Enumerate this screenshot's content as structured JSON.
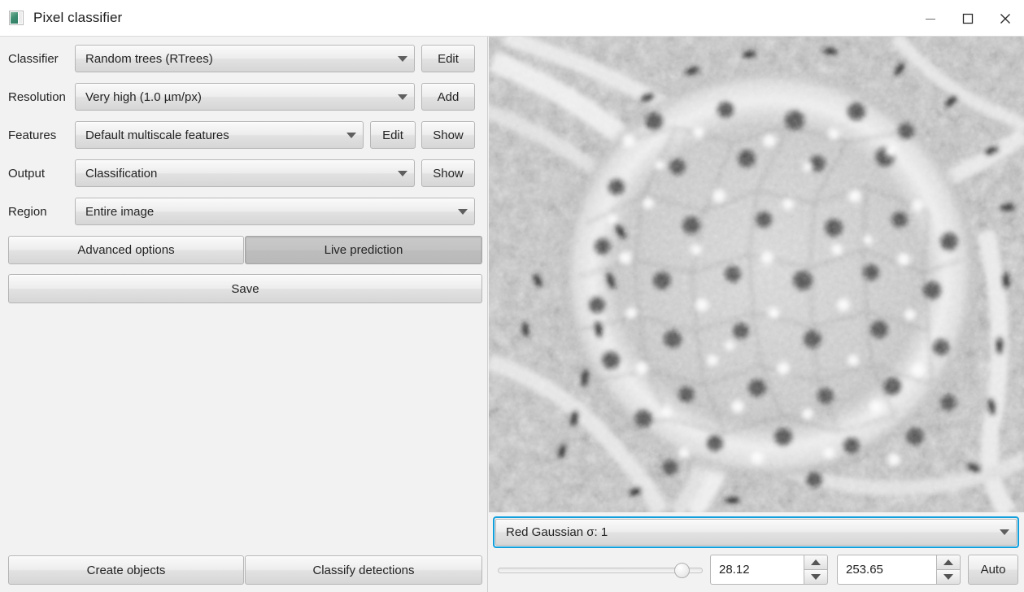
{
  "window": {
    "title": "Pixel classifier",
    "icon": "pixel-classifier-icon",
    "controls": {
      "minimize": "minimize-icon",
      "maximize": "maximize-icon",
      "close": "close-icon"
    }
  },
  "form": {
    "rows": [
      {
        "label": "Classifier",
        "value": "Random trees (RTrees)"
      },
      {
        "label": "Resolution",
        "value": "Very high (1.0 µm/px)"
      },
      {
        "label": "Features",
        "value": "Default multiscale features"
      },
      {
        "label": "Output",
        "value": "Classification"
      },
      {
        "label": "Region",
        "value": "Entire image"
      }
    ],
    "buttons": {
      "classifier_edit": "Edit",
      "resolution_add": "Add",
      "features_edit": "Edit",
      "features_show": "Show",
      "output_show": "Show"
    }
  },
  "actions": {
    "advanced_options": "Advanced options",
    "live_prediction": "Live prediction",
    "live_prediction_active": true,
    "save": "Save",
    "create_objects": "Create objects",
    "classify_detections": "Classify detections"
  },
  "display": {
    "channel": "Red Gaussian σ: 1",
    "focus_color": "#12a0dd",
    "min_value": "28.12",
    "max_value": "253.65",
    "auto": "Auto",
    "slider_percent": 93
  }
}
